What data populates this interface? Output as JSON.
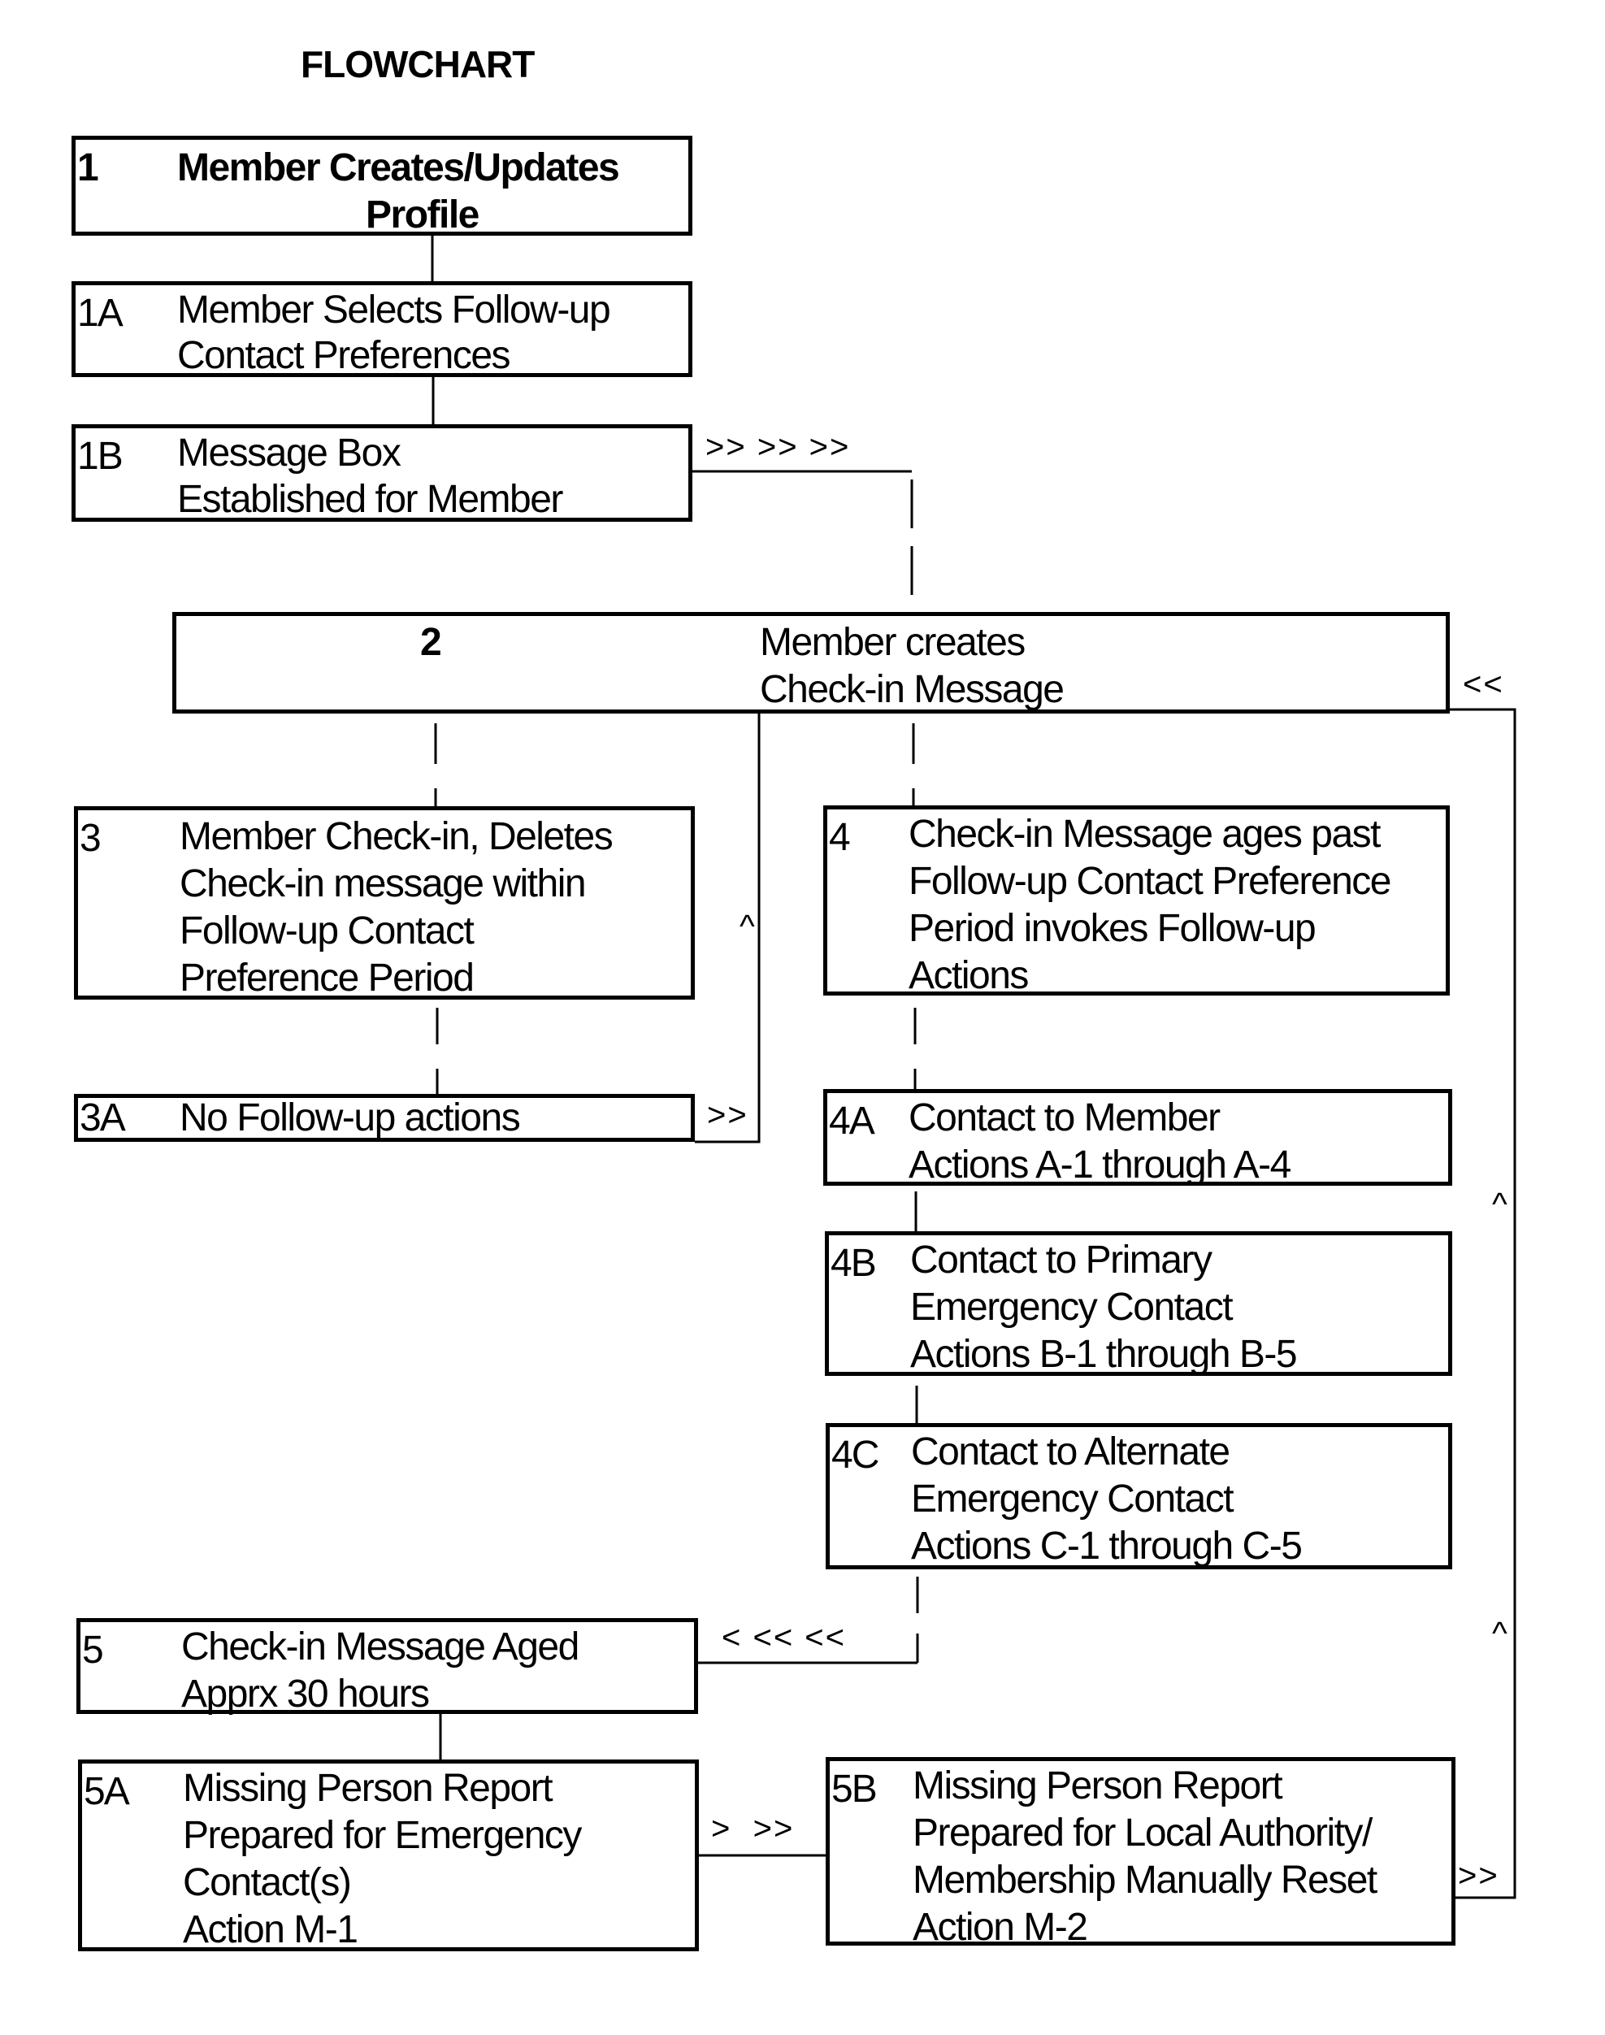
{
  "title": "FLOWCHART",
  "nodes": {
    "n1": {
      "id": "1",
      "lines": [
        "Member Creates/Updates",
        "Profile"
      ]
    },
    "n1a": {
      "id": "1A",
      "lines": [
        "Member Selects Follow-up",
        "Contact Preferences"
      ]
    },
    "n1b": {
      "id": "1B",
      "lines": [
        "Message Box",
        "Established for Member"
      ]
    },
    "n2": {
      "id": "2",
      "lines": [
        "Member creates",
        "Check-in Message"
      ]
    },
    "n3": {
      "id": "3",
      "lines": [
        "Member Check-in, Deletes",
        "Check-in message within",
        "Follow-up Contact",
        "Preference Period"
      ]
    },
    "n3a": {
      "id": "3A",
      "lines": [
        "No Follow-up actions"
      ]
    },
    "n4": {
      "id": "4",
      "lines": [
        "Check-in Message ages past",
        "Follow-up Contact Preference",
        "Period invokes Follow-up",
        "Actions"
      ]
    },
    "n4a": {
      "id": "4A",
      "lines": [
        "Contact to Member",
        "Actions A-1 through A-4"
      ]
    },
    "n4b": {
      "id": "4B",
      "lines": [
        "Contact to Primary",
        "Emergency Contact",
        "Actions B-1 through B-5"
      ]
    },
    "n4c": {
      "id": "4C",
      "lines": [
        "Contact to Alternate",
        "Emergency Contact",
        "Actions C-1 through C-5"
      ]
    },
    "n5": {
      "id": "5",
      "lines": [
        "Check-in Message Aged",
        "Apprx 30 hours"
      ]
    },
    "n5a": {
      "id": "5A",
      "lines": [
        "Missing Person Report",
        "Prepared for Emergency",
        "Contact(s)",
        "Action M-1"
      ]
    },
    "n5b": {
      "id": "5B",
      "lines": [
        "Missing Person Report",
        "Prepared for Local Authority/",
        "Membership Manually Reset",
        "Action M-2"
      ]
    }
  },
  "edges": [
    {
      "from": "1",
      "to": "1A",
      "style": "solid"
    },
    {
      "from": "1A",
      "to": "1B",
      "style": "solid"
    },
    {
      "from": "1B",
      "to": "2",
      "style": "dashed",
      "label": ">> >> >>"
    },
    {
      "from": "2",
      "to": "3",
      "style": "dashed"
    },
    {
      "from": "2",
      "to": "4",
      "style": "dashed"
    },
    {
      "from": "3",
      "to": "3A",
      "style": "dashed"
    },
    {
      "from": "3A",
      "to": "2",
      "style": "solid",
      "label": ">>",
      "label2": "^"
    },
    {
      "from": "4",
      "to": "4A",
      "style": "dashed"
    },
    {
      "from": "4A",
      "to": "4B",
      "style": "solid"
    },
    {
      "from": "4B",
      "to": "4C",
      "style": "solid"
    },
    {
      "from": "4C",
      "to": "5",
      "style": "dashed",
      "label": "< << <<"
    },
    {
      "from": "5",
      "to": "5A",
      "style": "solid"
    },
    {
      "from": "5A",
      "to": "5B",
      "style": "solid",
      "label": ">  >>"
    },
    {
      "from": "5B",
      "to": "2",
      "style": "solid",
      "label": ">>",
      "label2": "^",
      "label3": "^",
      "label4": "<<"
    }
  ],
  "marks": {
    "m1b": ">> >> >>",
    "m3a_out": ">>",
    "m3a_up": "^",
    "m2_in": "<<",
    "m4c_out": "< << <<",
    "m5a_out": ">  >>",
    "m5b_out": ">>",
    "m_loop_up1": "^",
    "m_loop_up2": "^"
  }
}
